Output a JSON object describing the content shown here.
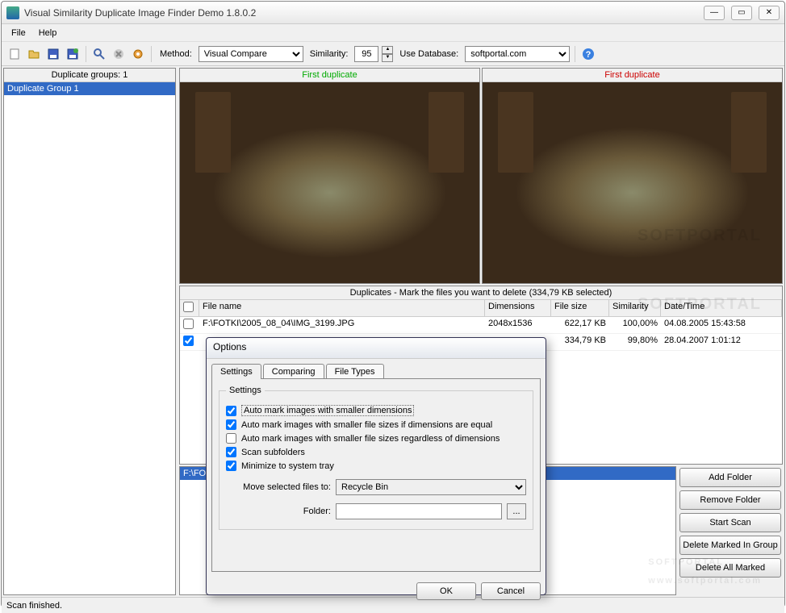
{
  "window": {
    "title": "Visual Similarity Duplicate Image Finder Demo 1.8.0.2"
  },
  "menu": {
    "file": "File",
    "help": "Help"
  },
  "toolbar": {
    "method_label": "Method:",
    "method_value": "Visual Compare",
    "similarity_label": "Similarity:",
    "similarity_value": "95",
    "usedb_label": "Use Database:",
    "usedb_value": "softportal.com"
  },
  "left": {
    "header": "Duplicate groups: 1",
    "group1": "Duplicate Group 1"
  },
  "preview": {
    "left_label": "First duplicate",
    "right_label": "First duplicate"
  },
  "dups": {
    "header": "Duplicates - Mark the files you want to delete (334,79 KB selected)",
    "cols": {
      "name": "File name",
      "dim": "Dimensions",
      "size": "File size",
      "sim": "Similarity",
      "date": "Date/Time"
    },
    "rows": [
      {
        "checked": false,
        "name": "F:\\FOTKI\\2005_08_04\\IMG_3199.JPG",
        "dim": "2048x1536",
        "size": "622,17 KB",
        "sim": "100,00%",
        "date": "04.08.2005 15:43:58"
      },
      {
        "checked": true,
        "name": "",
        "dim": "",
        "size": "334,79 KB",
        "sim": "99,80%",
        "date": "28.04.2007 1:01:12"
      }
    ]
  },
  "folders": {
    "selected": "F:\\FO"
  },
  "buttons": {
    "add": "Add Folder",
    "remove": "Remove Folder",
    "start": "Start Scan",
    "delgroup": "Delete Marked In Group",
    "delall": "Delete All Marked"
  },
  "status": "Scan finished.",
  "dialog": {
    "title": "Options",
    "tabs": {
      "settings": "Settings",
      "comparing": "Comparing",
      "filetypes": "File Types"
    },
    "fieldset": "Settings",
    "cb1": "Auto mark images with smaller dimensions",
    "cb2": "Auto mark images with smaller file sizes if dimensions are equal",
    "cb3": "Auto mark images with smaller file sizes regardless of dimensions",
    "cb4": "Scan subfolders",
    "cb5": "Minimize to system tray",
    "move_label": "Move selected files to:",
    "move_value": "Recycle Bin",
    "folder_label": "Folder:",
    "folder_value": "",
    "ok": "OK",
    "cancel": "Cancel"
  },
  "watermark": "SOFTPORTAL",
  "watermark_url": "www.softportal.com"
}
